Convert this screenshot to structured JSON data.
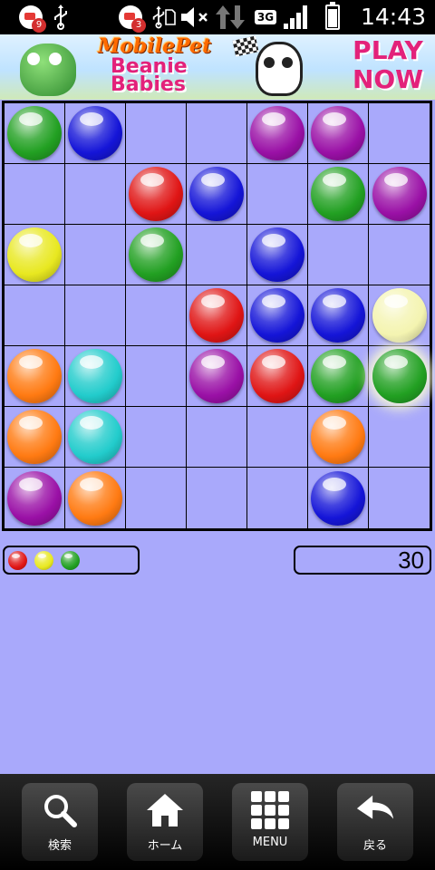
{
  "status_bar": {
    "notifications": [
      {
        "icon": "notification-app-icon",
        "count": "9"
      },
      {
        "icon": "usb-icon"
      },
      {
        "icon": "notification-app-icon",
        "count": "3"
      },
      {
        "icon": "usb-icon"
      },
      {
        "icon": "sd-card-icon"
      },
      {
        "icon": "volume-muted-icon"
      },
      {
        "icon": "data-transfer-icon"
      }
    ],
    "network_type": "3G",
    "signal_icon": "signal-strength-icon",
    "battery_icon": "battery-icon",
    "time": "14:43"
  },
  "ad": {
    "brand": "MobilePet",
    "title": "Beanie Babies",
    "cta": "PLAY NOW"
  },
  "colors": {
    "background": "#a9a9fb",
    "green": "#22a022",
    "blue": "#1515d8",
    "red": "#e01515",
    "purple": "#9a10a6",
    "yellow": "#e8e820",
    "orange": "#ff7a12",
    "cyan": "#22cccc",
    "pale_yellow": "#f4f4b0"
  },
  "board": {
    "rows": 7,
    "cols": 7,
    "selected": [
      4,
      6
    ],
    "grid": [
      [
        "green",
        "blue",
        null,
        null,
        "purple",
        "purple",
        null
      ],
      [
        null,
        null,
        "red",
        "blue",
        null,
        "green",
        "purple"
      ],
      [
        "yellow",
        null,
        "green",
        null,
        "blue",
        null,
        null
      ],
      [
        null,
        null,
        null,
        "red",
        "blue",
        "blue",
        "pale_yellow"
      ],
      [
        "orange",
        "cyan",
        null,
        "purple",
        "red",
        "green",
        "green"
      ],
      [
        "orange",
        "cyan",
        null,
        null,
        null,
        "orange",
        null
      ],
      [
        "purple",
        "orange",
        null,
        null,
        null,
        "blue",
        null
      ]
    ]
  },
  "next_balls": [
    "red",
    "yellow",
    "green"
  ],
  "score": "30",
  "nav": [
    {
      "icon": "search-icon",
      "label": "検索"
    },
    {
      "icon": "home-icon",
      "label": "ホーム"
    },
    {
      "icon": "menu-grid-icon",
      "label": "MENU"
    },
    {
      "icon": "back-arrow-icon",
      "label": "戻る"
    }
  ]
}
